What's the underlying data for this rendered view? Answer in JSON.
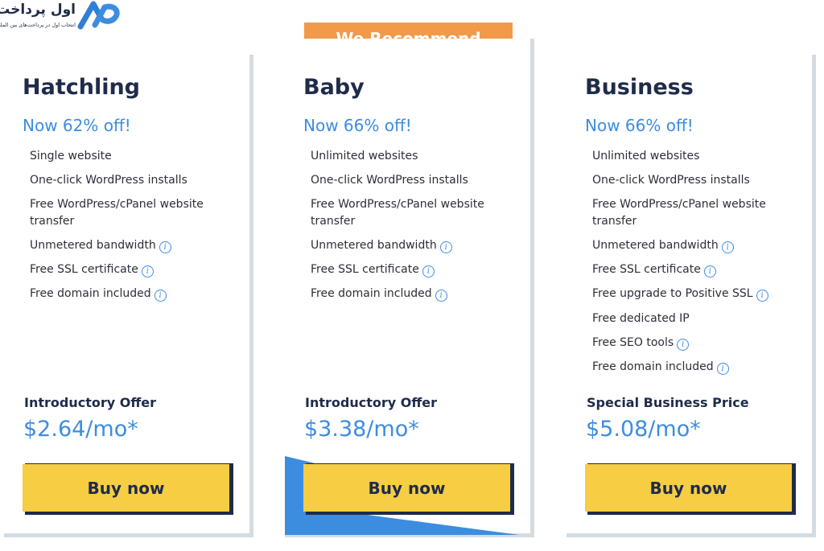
{
  "logo": {
    "name": "اول پرداخت",
    "tagline": "انتخاب اول در پرداخت‌های بین المللی"
  },
  "badge": "We Recommend",
  "colors": {
    "accent_blue": "#3c8de0",
    "navy": "#1f2b4a",
    "button_yellow": "#f6cd43",
    "badge_orange": "#f2994a",
    "frame_gray": "#d3dce3"
  },
  "plans": [
    {
      "name": "Hatchling",
      "discount": "Now 62% off!",
      "features": [
        {
          "text": "Single website",
          "info": false
        },
        {
          "text": "One-click WordPress installs",
          "info": false
        },
        {
          "text": "Free WordPress/cPanel website transfer",
          "info": false
        },
        {
          "text": "Unmetered bandwidth",
          "info": true
        },
        {
          "text": "Free SSL certificate",
          "info": true
        },
        {
          "text": "Free domain included",
          "info": true
        }
      ],
      "offer_label": "Introductory Offer",
      "price": "$2.64/mo*",
      "button": "Buy now"
    },
    {
      "name": "Baby",
      "discount": "Now 66% off!",
      "features": [
        {
          "text": "Unlimited websites",
          "info": false
        },
        {
          "text": "One-click WordPress installs",
          "info": false
        },
        {
          "text": "Free WordPress/cPanel website transfer",
          "info": false
        },
        {
          "text": "Unmetered bandwidth",
          "info": true
        },
        {
          "text": "Free SSL certificate",
          "info": true
        },
        {
          "text": "Free domain included",
          "info": true
        }
      ],
      "offer_label": "Introductory Offer",
      "price": "$3.38/mo*",
      "button": "Buy now"
    },
    {
      "name": "Business",
      "discount": "Now 66% off!",
      "features": [
        {
          "text": "Unlimited websites",
          "info": false
        },
        {
          "text": "One-click WordPress installs",
          "info": false
        },
        {
          "text": "Free WordPress/cPanel website transfer",
          "info": false
        },
        {
          "text": "Unmetered bandwidth",
          "info": true
        },
        {
          "text": "Free SSL certificate",
          "info": true
        },
        {
          "text": "Free upgrade to Positive SSL",
          "info": true
        },
        {
          "text": "Free dedicated IP",
          "info": false
        },
        {
          "text": "Free SEO tools",
          "info": true
        },
        {
          "text": "Free domain included",
          "info": true
        }
      ],
      "offer_label": "Special Business Price",
      "price": "$5.08/mo*",
      "button": "Buy now"
    }
  ]
}
